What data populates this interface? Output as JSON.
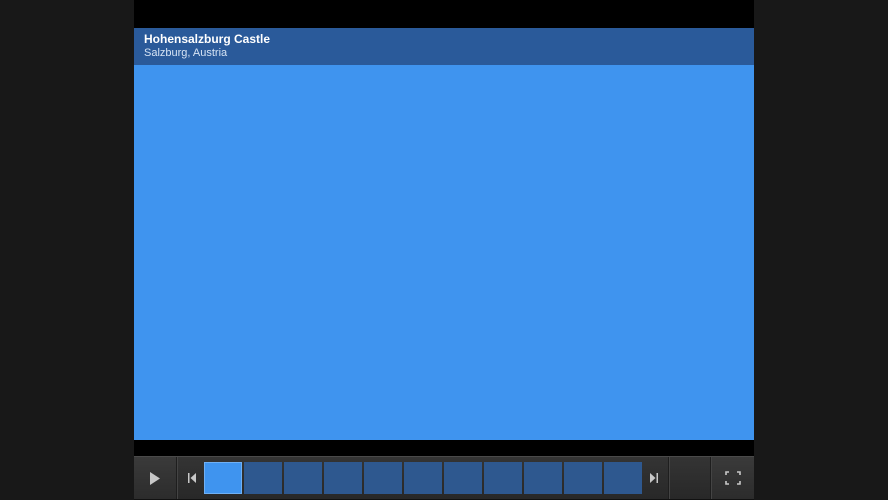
{
  "caption": {
    "title": "Hohensalzburg Castle",
    "subtitle": "Salzburg, Austria"
  },
  "thumbnails": {
    "count": 11,
    "active_index": 0
  },
  "colors": {
    "main_image": "#3f94ef",
    "thumb_inactive": "#2e588f",
    "thumb_active": "#3f94ef",
    "caption_bg": "#2a5a9a"
  },
  "icons": {
    "play": "play-icon",
    "prev": "skip-prev-icon",
    "next": "skip-next-icon",
    "fullscreen": "fullscreen-icon"
  }
}
